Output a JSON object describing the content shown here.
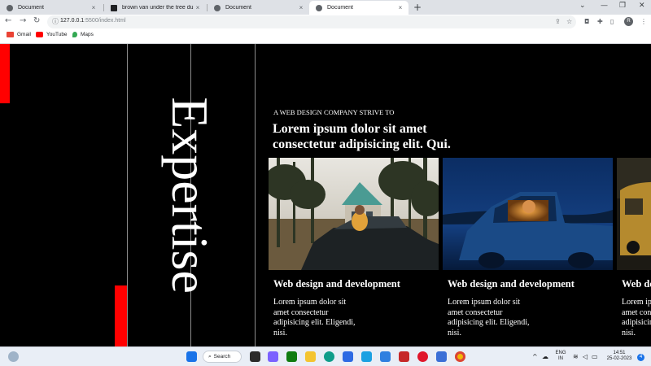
{
  "browser": {
    "tabs": [
      {
        "title": "Document",
        "active": false
      },
      {
        "title": "brown van under the tree during",
        "active": false
      },
      {
        "title": "Document",
        "active": false
      },
      {
        "title": "Document",
        "active": true
      }
    ],
    "new_tab_symbol": "+",
    "close_symbol": "×",
    "url_host": "127.0.0.1",
    "url_rest": ":5500/index.html",
    "profile_initial": "R",
    "bookmarks": [
      {
        "label": "Gmail",
        "icon": "gmail-icon",
        "color": "#ea4335"
      },
      {
        "label": "YouTube",
        "icon": "youtube-icon",
        "color": "#ff0000"
      },
      {
        "label": "Maps",
        "icon": "maps-icon",
        "color": "#34a853"
      }
    ]
  },
  "page": {
    "vertical_title": "Expertise",
    "subtitle": "A WEB DESIGN COMPANY STRIVE TO",
    "headline": "Lorem ipsum dolor sit amet consectetur adipisicing elit. Qui.",
    "accent_color": "#ff0000",
    "cards": [
      {
        "title": "Web design and development",
        "description": "Lorem ipsum dolor sit amet consectetur adipisicing elit. Eligendi, nisi.",
        "image": "car-with-child-in-forest-photo"
      },
      {
        "title": "Web design and development",
        "description": "Lorem ipsum dolor sit amet consectetur adipisicing elit. Eligendi, nisi.",
        "image": "blue-truck-at-night-photo"
      },
      {
        "title": "Web design and development",
        "description": "Lorem ipsum dolor sit amet consectetur adipisicing elit. Eligendi, nisi.",
        "image": "van-photo"
      }
    ]
  },
  "taskbar": {
    "search_label": "Search",
    "language": "ENG",
    "region": "IN",
    "time": "14:51",
    "date": "25-02-2023",
    "notification_count": "4"
  }
}
